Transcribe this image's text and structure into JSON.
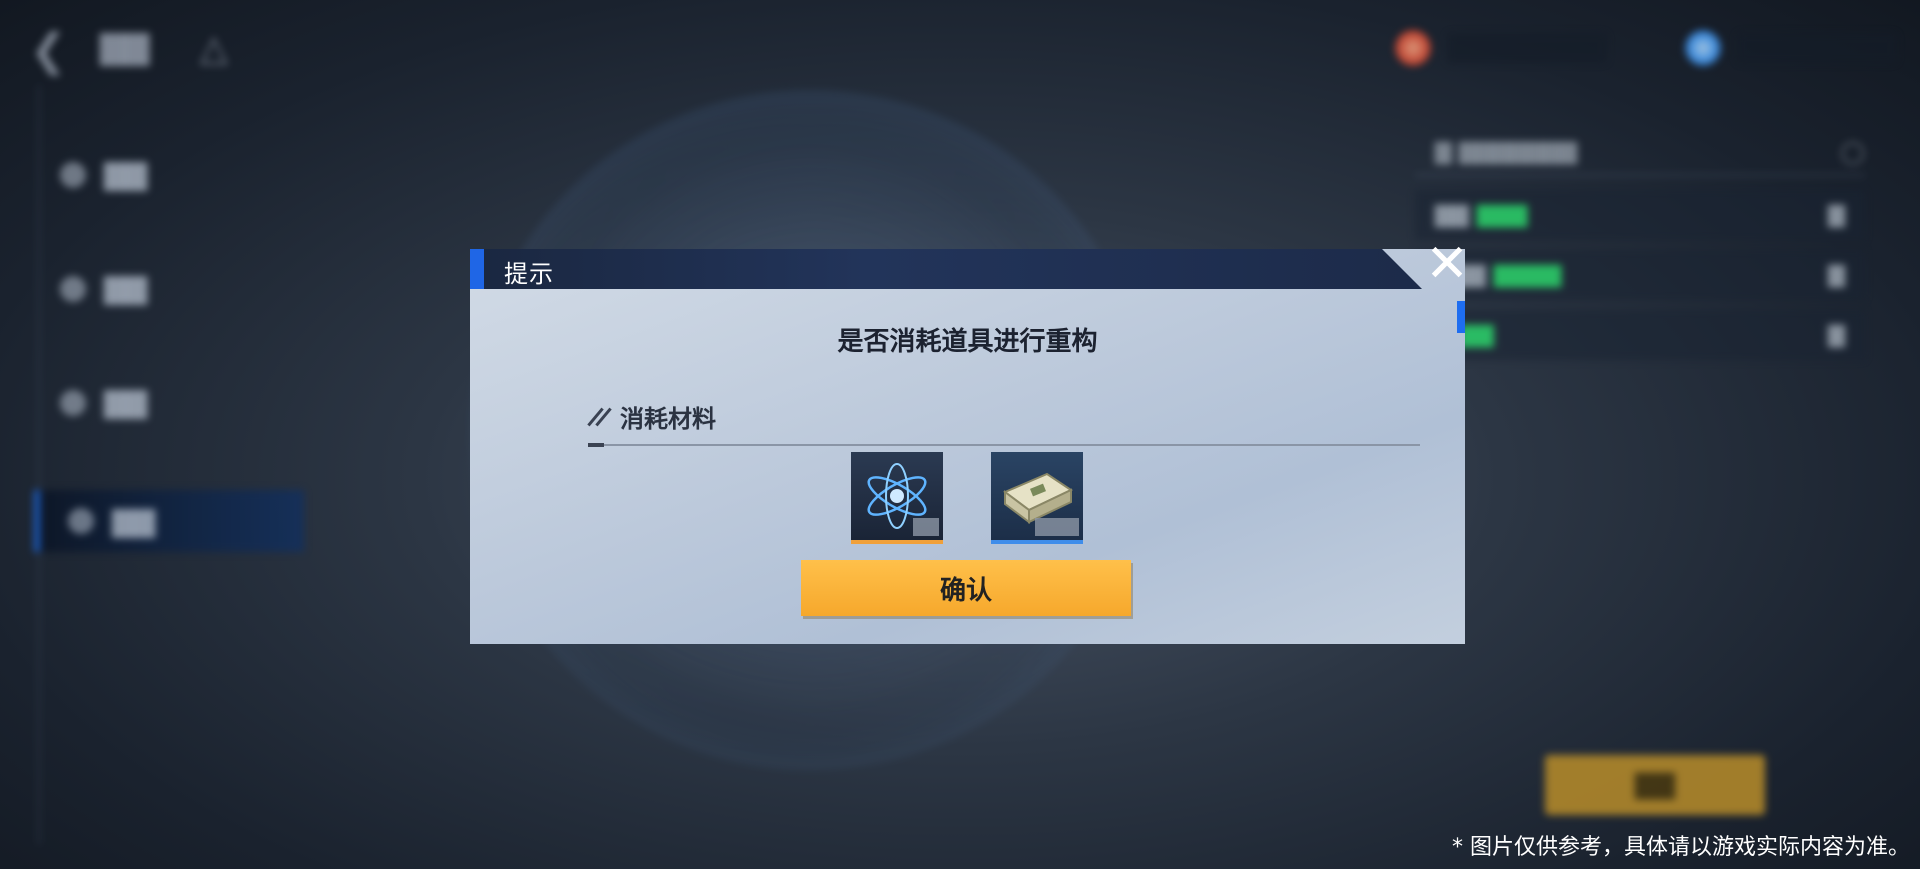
{
  "background": {
    "topbar": {
      "back_icon": "chevron-left-icon",
      "home_icon": "home-icon"
    },
    "resources": [
      {
        "icon": "red-orb-icon",
        "color": "#e0523a"
      },
      {
        "icon": "blue-atom-icon",
        "color": "#4aa3ff"
      }
    ],
    "sidebar_icons": [
      "dot-icon",
      "dot-icon",
      "dot-icon",
      "dot-icon"
    ],
    "confirm_bg_color": "#b98d2a"
  },
  "dialog": {
    "title": "提示",
    "question": "是否消耗道具进行重构",
    "section_label": "消耗材料",
    "items": [
      {
        "icon": "blue-atom-item-icon",
        "rarity_color": "#f0a03a"
      },
      {
        "icon": "cash-bundle-item-icon",
        "rarity_color": "#3f8dea"
      }
    ],
    "confirm_label": "确认",
    "close_icon": "close-icon",
    "accent_color": "#1f66e6",
    "button_color": "#f6a82c"
  },
  "disclaimer": "* 图片仅供参考，具体请以游戏实际内容为准。"
}
